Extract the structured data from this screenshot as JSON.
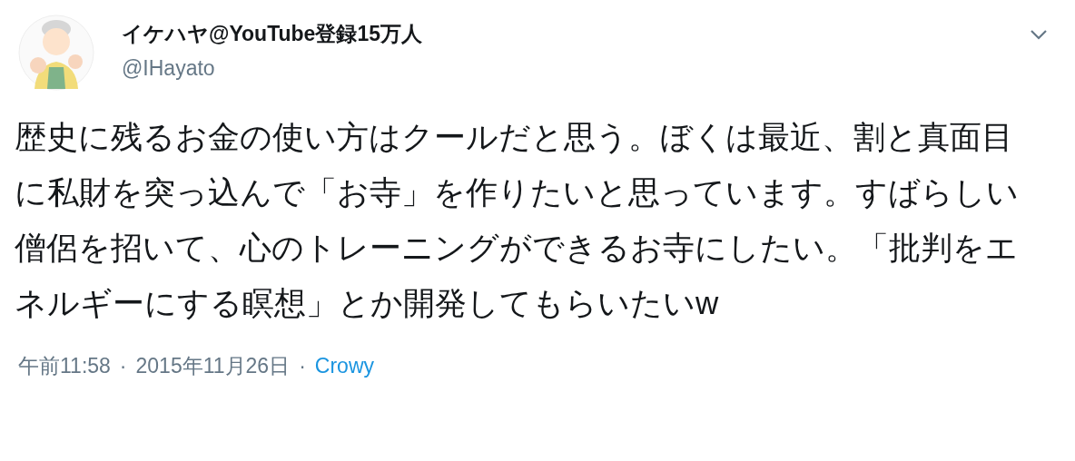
{
  "author": {
    "display_name": "イケハヤ@YouTube登録15万人",
    "handle": "@IHayato"
  },
  "body": "歴史に残るお金の使い方はクールだと思う。ぼくは最近、割と真面目に私財を突っ込んで「お寺」を作りたいと思っています。すばらしい僧侶を招いて、心のトレーニングができるお寺にしたい。「批判をエネルギーにする瞑想」とか開発してもらいたいw",
  "meta": {
    "time": "午前11:58",
    "separator_1": "·",
    "date": "2015年11月26日",
    "separator_2": "·",
    "source": "Crowy"
  }
}
